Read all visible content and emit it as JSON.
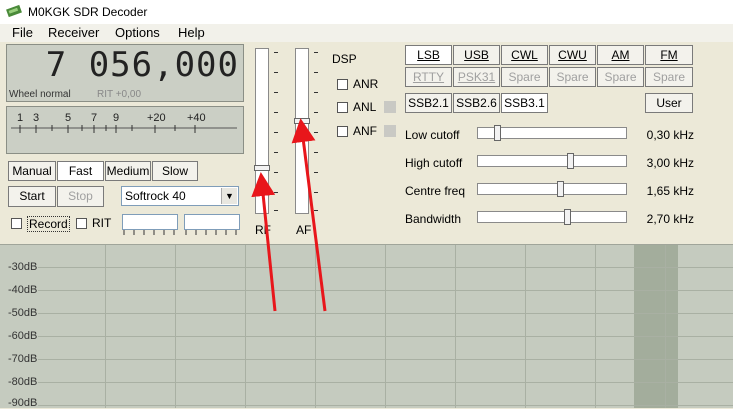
{
  "window": {
    "title": "M0KGK SDR Decoder"
  },
  "menu": [
    "File",
    "Receiver",
    "Options",
    "Help"
  ],
  "frequency": {
    "display": "7 056,000",
    "wheel": "Wheel normal",
    "rit": "RIT +0,00"
  },
  "smeter": {
    "labels": [
      "1",
      "3",
      "5",
      "7",
      "9",
      "+20",
      "+40"
    ]
  },
  "agc": {
    "manual": "Manual",
    "fast": "Fast",
    "medium": "Medium",
    "slow": "Slow"
  },
  "controls": {
    "start": "Start",
    "stop": "Stop",
    "device": "Softrock 40",
    "record": "Record",
    "rit": "RIT"
  },
  "sliders": {
    "rf": "RF",
    "af": "AF"
  },
  "dsp": {
    "title": "DSP",
    "anr": "ANR",
    "anl": "ANL",
    "anf": "ANF"
  },
  "modes": {
    "row1": [
      "LSB",
      "USB",
      "CWL",
      "CWU",
      "AM",
      "FM"
    ],
    "row2": [
      "RTTY",
      "PSK31",
      "Spare",
      "Spare",
      "Spare",
      "Spare"
    ],
    "row3": [
      "SSB2.1",
      "SSB2.6",
      "SSB3.1"
    ],
    "user": "User"
  },
  "filters": [
    {
      "label": "Low cutoff",
      "value": "0,30 kHz",
      "level": 0.12
    },
    {
      "label": "High cutoff",
      "value": "3,00 kHz",
      "level": 0.63
    },
    {
      "label": "Centre freq",
      "value": "1,65 kHz",
      "level": 0.56
    },
    {
      "label": "Bandwidth",
      "value": "2,70 kHz",
      "level": 0.61
    }
  ],
  "spectrum": {
    "db_labels": [
      "-30dB",
      "-40dB",
      "-50dB",
      "-60dB",
      "-70dB",
      "-80dB",
      "-90dB"
    ]
  },
  "colors": {
    "annotation_arrow": "#e8161b",
    "display_bg": "#cbcfc5",
    "spectrum_bg": "#c5cbbf",
    "passband": "#a3ad9c"
  }
}
